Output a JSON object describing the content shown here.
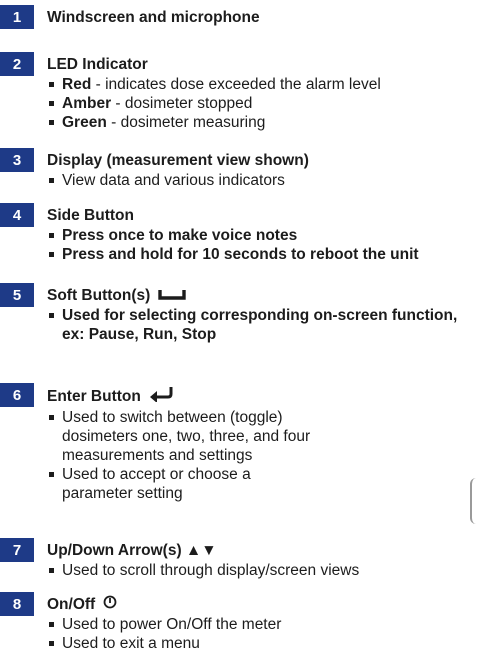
{
  "items": [
    {
      "number": "1",
      "title": "Windscreen and microphone"
    },
    {
      "number": "2",
      "title": "LED Indicator",
      "bullets": [
        {
          "term": "Red",
          "text": " - indicates dose exceeded the alarm level"
        },
        {
          "term": "Amber",
          "text": " - dosimeter stopped"
        },
        {
          "term": "Green",
          "text": " - dosimeter measuring"
        }
      ]
    },
    {
      "number": "3",
      "title": "Display (measurement view shown)",
      "bullets": [
        "View data and various indicators"
      ]
    },
    {
      "number": "4",
      "title": "Side Button",
      "bullets": [
        "Press once to make voice notes",
        "Press and hold for 10 seconds to reboot the unit"
      ]
    },
    {
      "number": "5",
      "title": "Soft Button(s)",
      "icon": "soft-button-icon",
      "bullets": [
        "Used for selecting corresponding on-screen function, ex: Pause, Run, Stop"
      ]
    },
    {
      "number": "6",
      "title": "Enter Button",
      "icon": "enter-arrow-icon",
      "bullets": [
        "Used to switch between (toggle) dosimeters one, two, three, and four measurements and settings",
        "Used to accept or choose a parameter setting"
      ]
    },
    {
      "number": "7",
      "title": "Up/Down Arrow(s) ▲▼",
      "icon": "up-down-arrow-icon",
      "bullets": [
        "Used to scroll through display/screen views"
      ]
    },
    {
      "number": "8",
      "title": "On/Off",
      "icon": "power-icon",
      "bullets": [
        "Used to power On/Off the meter",
        "Used to exit a menu"
      ]
    }
  ],
  "colors": {
    "badge": "#1e3a87",
    "text": "#1c1c1c"
  }
}
